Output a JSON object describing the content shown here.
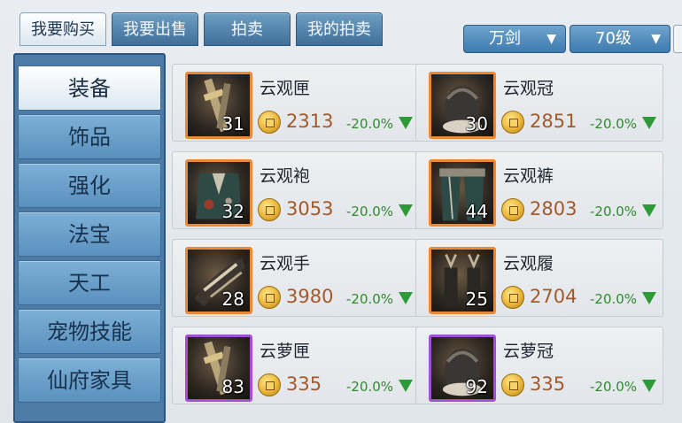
{
  "tabs": [
    {
      "label": "我要购买",
      "active": true
    },
    {
      "label": "我要出售",
      "active": false
    },
    {
      "label": "拍卖",
      "active": false
    },
    {
      "label": "我的拍卖",
      "active": false
    }
  ],
  "filters": {
    "school": "万剑",
    "level": "70级"
  },
  "sidebar": {
    "items": [
      {
        "label": "装备",
        "active": true
      },
      {
        "label": "饰品",
        "active": false
      },
      {
        "label": "强化",
        "active": false
      },
      {
        "label": "法宝",
        "active": false
      },
      {
        "label": "天工",
        "active": false
      },
      {
        "label": "宠物技能",
        "active": false
      },
      {
        "label": "仙府家具",
        "active": false
      }
    ]
  },
  "items": [
    {
      "name": "云观匣",
      "level": "31",
      "price": "2313",
      "change": "-20.0%",
      "rarity": "orange",
      "icon": "box-weapon-icon"
    },
    {
      "name": "云观冠",
      "level": "30",
      "price": "2851",
      "change": "-20.0%",
      "rarity": "orange",
      "icon": "crown-icon"
    },
    {
      "name": "云观袍",
      "level": "32",
      "price": "3053",
      "change": "-20.0%",
      "rarity": "orange",
      "icon": "robe-icon"
    },
    {
      "name": "云观裤",
      "level": "44",
      "price": "2803",
      "change": "-20.0%",
      "rarity": "orange",
      "icon": "pants-icon"
    },
    {
      "name": "云观手",
      "level": "28",
      "price": "3980",
      "change": "-20.0%",
      "rarity": "orange",
      "icon": "glove-icon"
    },
    {
      "name": "云观履",
      "level": "25",
      "price": "2704",
      "change": "-20.0%",
      "rarity": "orange",
      "icon": "boots-icon"
    },
    {
      "name": "云萝匣",
      "level": "83",
      "price": "335",
      "change": "-20.0%",
      "rarity": "purple",
      "icon": "box-weapon-icon"
    },
    {
      "name": "云萝冠",
      "level": "92",
      "price": "335",
      "change": "-20.0%",
      "rarity": "purple",
      "icon": "crown-icon"
    }
  ],
  "colors": {
    "tab_active": "#ffffff",
    "tab_inactive": "#4f80aa",
    "price_text": "#a4592a",
    "change_text": "#2f8a2f",
    "orange_rarity": "#e98a3b",
    "purple_rarity": "#a44fcf"
  }
}
